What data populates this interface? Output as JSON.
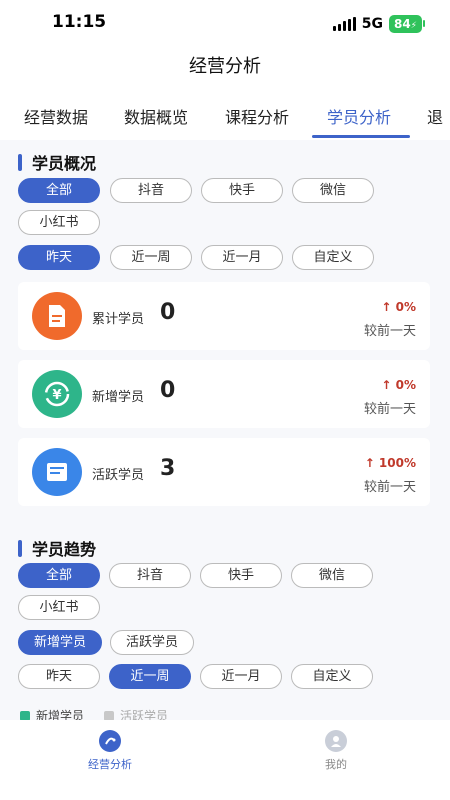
{
  "status_bar": {
    "time": "11:15",
    "network": "5G",
    "battery": "84"
  },
  "header": {
    "title": "经营分析"
  },
  "tabs": [
    {
      "label": "经营数据"
    },
    {
      "label": "数据概览"
    },
    {
      "label": "课程分析"
    },
    {
      "label": "学员分析",
      "active": true
    },
    {
      "label": "退"
    }
  ],
  "overview": {
    "title": "学员概况",
    "platform_filters": [
      "全部",
      "抖音",
      "快手",
      "微信",
      "小红书"
    ],
    "platform_selected": "全部",
    "time_filters": [
      "昨天",
      "近一周",
      "近一月",
      "自定义"
    ],
    "time_selected": "昨天",
    "stats": [
      {
        "label": "累计学员",
        "value": "0",
        "change": "↑ 0%",
        "compare": "较前一天",
        "icon": "document-icon",
        "color": "#f06a2c"
      },
      {
        "label": "新增学员",
        "value": "0",
        "change": "↑ 0%",
        "compare": "较前一天",
        "icon": "yuan-refresh-icon",
        "color": "#2eb58a"
      },
      {
        "label": "活跃学员",
        "value": "3",
        "change": "↑ 100%",
        "compare": "较前一天",
        "icon": "book-icon",
        "color": "#3a86e8"
      }
    ]
  },
  "trend": {
    "title": "学员趋势",
    "platform_filters": [
      "全部",
      "抖音",
      "快手",
      "微信",
      "小红书"
    ],
    "platform_selected": "全部",
    "type_filters": [
      "新增学员",
      "活跃学员"
    ],
    "type_selected": "新增学员",
    "time_filters": [
      "昨天",
      "近一周",
      "近一月",
      "自定义"
    ],
    "time_selected": "近一周",
    "legend": [
      {
        "label": "新增学员",
        "color": "#2eb58a"
      },
      {
        "label": "活跃学员",
        "color": "#c8c8c8"
      }
    ]
  },
  "bottom_nav": [
    {
      "label": "经营分析",
      "icon": "analysis-icon",
      "active": true
    },
    {
      "label": "我的",
      "icon": "profile-icon",
      "active": false
    }
  ],
  "colors": {
    "accent": "#3d63c9",
    "positive_change": "#c0392b"
  }
}
